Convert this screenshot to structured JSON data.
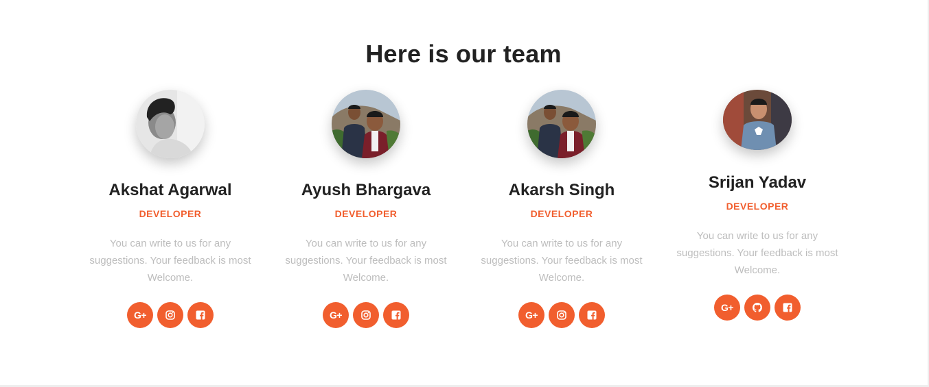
{
  "section": {
    "title": "Here is our team"
  },
  "members": [
    {
      "name": "Akshat Agarwal",
      "role": "DEVELOPER",
      "description": "You can write to us for any suggestions. Your feedback is most Welcome.",
      "socials": [
        "google-plus-icon",
        "instagram-icon",
        "facebook-icon"
      ]
    },
    {
      "name": "Ayush Bhargava",
      "role": "DEVELOPER",
      "description": "You can write to us for any suggestions. Your feedback is most Welcome.",
      "socials": [
        "google-plus-icon",
        "instagram-icon",
        "facebook-icon"
      ]
    },
    {
      "name": "Akarsh Singh",
      "role": "DEVELOPER",
      "description": "You can write to us for any suggestions. Your feedback is most Welcome.",
      "socials": [
        "google-plus-icon",
        "instagram-icon",
        "facebook-icon"
      ]
    },
    {
      "name": "Srijan Yadav",
      "role": "DEVELOPER",
      "description": "You can write to us for any suggestions. Your feedback is most Welcome.",
      "socials": [
        "google-plus-icon",
        "github-icon",
        "facebook-icon"
      ]
    }
  ],
  "icons": {
    "google_plus_glyph": "G+"
  },
  "colors": {
    "accent": "#f15e2e",
    "heading": "#222222",
    "muted_text": "#bdbdbd",
    "background": "#ffffff"
  }
}
